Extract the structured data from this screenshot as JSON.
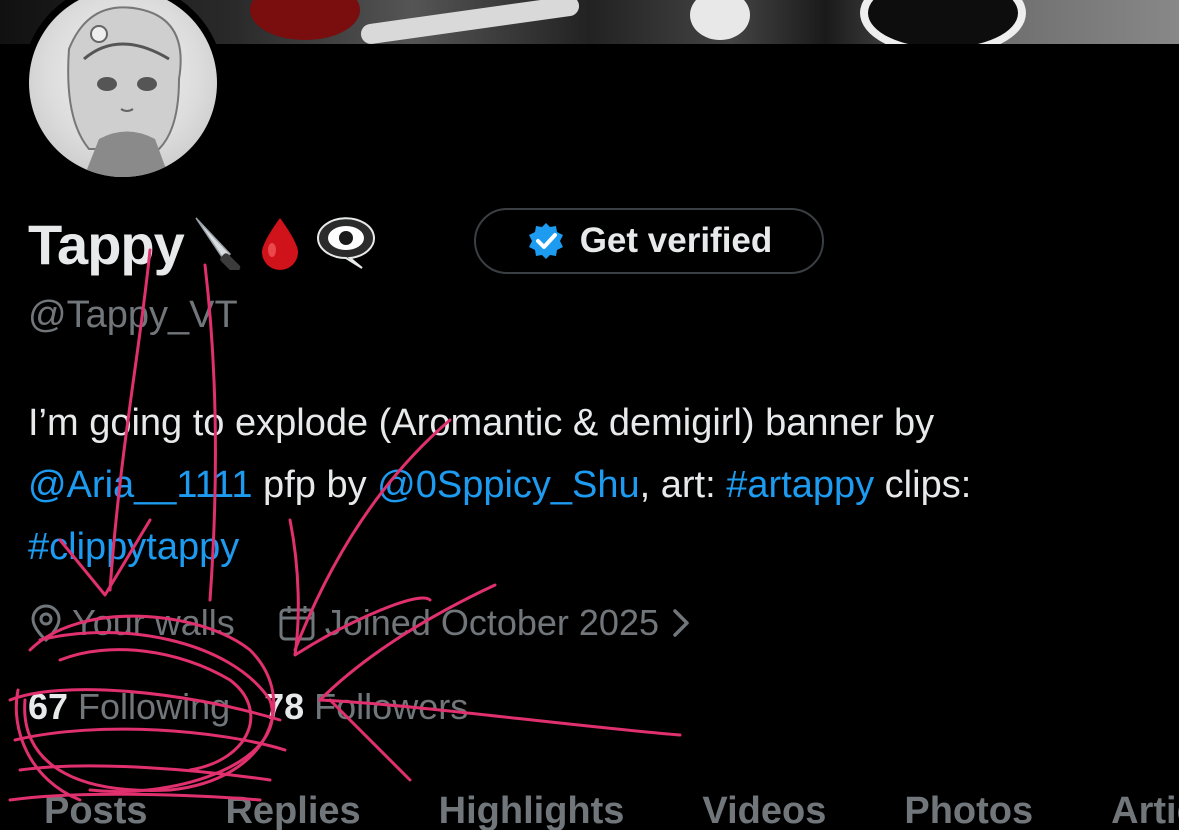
{
  "profile": {
    "display_name": "Tappy",
    "name_emojis": [
      "knife-emoji",
      "blood-drop-emoji",
      "eye-speech-bubble-emoji"
    ],
    "handle": "@Tappy_VT",
    "verify_button_label": "Get verified"
  },
  "bio": {
    "text_1": "I’m going to explode (Aromantic & demigirl) banner by ",
    "link_banner_artist": "@Aria__1111",
    "text_2": " pfp by ",
    "link_pfp_artist": "@0Sppicy_Shu",
    "text_3": ", art: ",
    "hashtag_art": "#artappy",
    "text_4": " clips: ",
    "hashtag_clips": "#clippytappy"
  },
  "meta": {
    "location": "Your walls",
    "location_icon": "location-pin-icon",
    "joined": "Joined October 2025",
    "joined_icon": "calendar-icon",
    "chevron_icon": "chevron-right-icon"
  },
  "counts": {
    "following_value": "67",
    "following_label": "Following",
    "followers_value": "78",
    "followers_label": "Followers"
  },
  "tabs": [
    "Posts",
    "Replies",
    "Highlights",
    "Videos",
    "Photos",
    "Articles"
  ],
  "colors": {
    "background": "#000000",
    "text_primary": "#e7e9ea",
    "text_secondary": "#71767b",
    "link": "#1d9bf0",
    "verify_badge": "#1d9bf0",
    "annotation_scribble": "#e0306e"
  }
}
